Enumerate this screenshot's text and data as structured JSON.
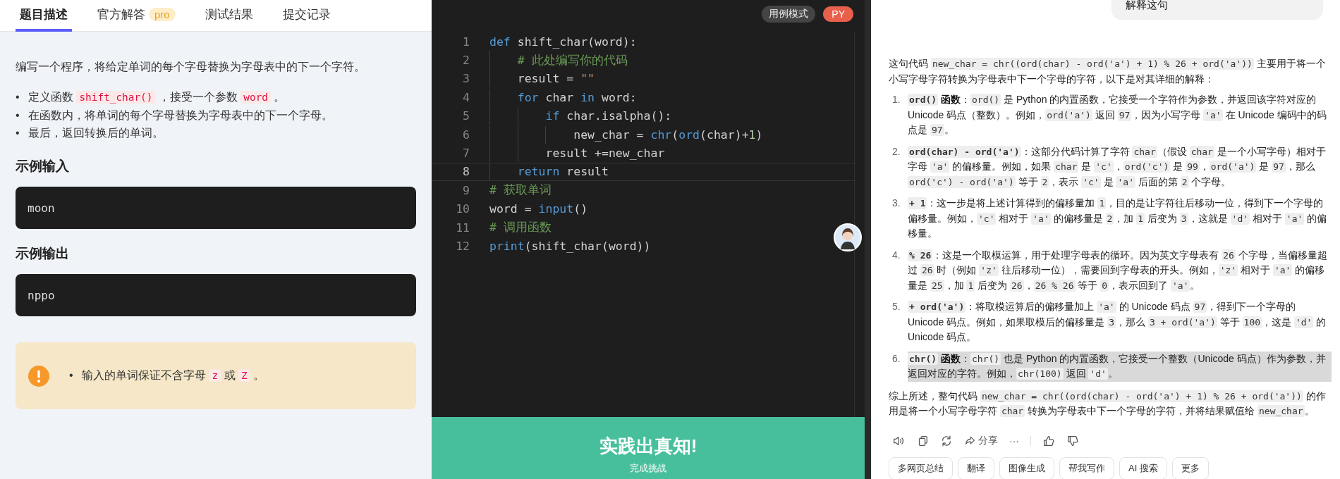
{
  "problem": {
    "tabs": [
      {
        "label": "题目描述",
        "selected": true
      },
      {
        "label": "官方解答",
        "selected": false,
        "badge": "pro"
      },
      {
        "label": "测试结果",
        "selected": false
      },
      {
        "label": "提交记录",
        "selected": false
      }
    ],
    "description": "编写一个程序，将给定单词的每个字母替换为字母表中的下一个字符。",
    "bullets": [
      {
        "marker": "•",
        "segments": [
          {
            "kind": "text",
            "text": "定义函数 "
          },
          {
            "kind": "code",
            "text": "shift_char()"
          },
          {
            "kind": "text",
            "text": " ，接受一个参数 "
          },
          {
            "kind": "code",
            "text": "word"
          },
          {
            "kind": "text",
            "text": " 。"
          }
        ]
      },
      {
        "marker": "•",
        "segments": [
          {
            "kind": "text",
            "text": "在函数内，将单词的每个字母替换为字母表中的下一个字母。"
          }
        ]
      },
      {
        "marker": "•",
        "segments": [
          {
            "kind": "text",
            "text": "最后，返回转换后的单词。"
          }
        ]
      }
    ],
    "examples": [
      {
        "heading": "示例输入",
        "value": "moon"
      },
      {
        "heading": "示例输出",
        "value": "nppo"
      }
    ],
    "notice": [
      {
        "marker": "•",
        "segments": [
          {
            "kind": "text",
            "text": "输入的单词保证不含字母 "
          },
          {
            "kind": "code",
            "text": "z"
          },
          {
            "kind": "text",
            "text": " 或 "
          },
          {
            "kind": "code",
            "text": "Z"
          },
          {
            "kind": "text",
            "text": " 。"
          }
        ]
      }
    ]
  },
  "editor": {
    "mode_badge": "用例模式",
    "language_badge": "PY",
    "lines": [
      {
        "number": "1",
        "current": false,
        "tokens": [
          {
            "kind": "keyword",
            "text": "def"
          },
          {
            "kind": "plain",
            "text": " shift_char(word):"
          }
        ]
      },
      {
        "number": "2",
        "current": false,
        "tokens": [
          {
            "kind": "comment",
            "text": "    # 此处编写你的代码"
          }
        ]
      },
      {
        "number": "3",
        "current": false,
        "tokens": [
          {
            "kind": "plain",
            "text": "    result = "
          },
          {
            "kind": "string",
            "text": "\"\""
          }
        ]
      },
      {
        "number": "4",
        "current": false,
        "tokens": [
          {
            "kind": "keyword",
            "text": "    for"
          },
          {
            "kind": "plain",
            "text": " char "
          },
          {
            "kind": "keyword",
            "text": "in"
          },
          {
            "kind": "plain",
            "text": " word:"
          }
        ]
      },
      {
        "number": "5",
        "current": false,
        "tokens": [
          {
            "kind": "keyword",
            "text": "        if"
          },
          {
            "kind": "plain",
            "text": " char.isalpha():"
          }
        ]
      },
      {
        "number": "6",
        "current": false,
        "tokens": [
          {
            "kind": "plain",
            "text": "            new_char = "
          },
          {
            "kind": "function",
            "text": "chr"
          },
          {
            "kind": "plain",
            "text": "("
          },
          {
            "kind": "function",
            "text": "ord"
          },
          {
            "kind": "plain",
            "text": "(char)+"
          },
          {
            "kind": "number",
            "text": "1"
          },
          {
            "kind": "plain",
            "text": ")"
          }
        ]
      },
      {
        "number": "7",
        "current": false,
        "tokens": [
          {
            "kind": "plain",
            "text": "        result +=new_char"
          }
        ]
      },
      {
        "number": "8",
        "current": true,
        "tokens": [
          {
            "kind": "keyword",
            "text": "    return"
          },
          {
            "kind": "plain",
            "text": " result"
          }
        ]
      },
      {
        "number": "9",
        "current": false,
        "tokens": [
          {
            "kind": "comment",
            "text": "# 获取单词"
          }
        ]
      },
      {
        "number": "10",
        "current": false,
        "tokens": [
          {
            "kind": "plain",
            "text": "word = "
          },
          {
            "kind": "function",
            "text": "input"
          },
          {
            "kind": "plain",
            "text": "()"
          }
        ]
      },
      {
        "number": "11",
        "current": false,
        "tokens": [
          {
            "kind": "comment",
            "text": "# 调用函数"
          }
        ]
      },
      {
        "number": "12",
        "current": false,
        "tokens": [
          {
            "kind": "function",
            "text": "print"
          },
          {
            "kind": "plain",
            "text": "(shift_char(word))"
          }
        ]
      }
    ]
  },
  "banner": {
    "title": "实践出真知!",
    "subtitle": "完成挑战"
  },
  "chat": {
    "user_message": "解释这句",
    "intro": [
      {
        "kind": "text",
        "text": "这句代码 "
      },
      {
        "kind": "code",
        "text": "new_char = chr((ord(char) - ord('a') + 1) % 26 + ord('a'))"
      },
      {
        "kind": "text",
        "text": " 主要用于将一个小写字母字符转换为字母表中下一个字母的字符，以下是对其详细的解释："
      }
    ],
    "items": [
      {
        "number": "1.",
        "highlighted": false,
        "segments": [
          {
            "kind": "bold-code",
            "text": "ord()"
          },
          {
            "kind": "bold",
            "text": " 函数"
          },
          {
            "kind": "text",
            "text": "："
          },
          {
            "kind": "code",
            "text": "ord()"
          },
          {
            "kind": "text",
            "text": " 是 Python 的内置函数，它接受一个字符作为参数，并返回该字符对应的 Unicode 码点（整数）。例如，"
          },
          {
            "kind": "code",
            "text": "ord('a')"
          },
          {
            "kind": "text",
            "text": " 返回 "
          },
          {
            "kind": "code",
            "text": "97"
          },
          {
            "kind": "text",
            "text": "，因为小写字母 "
          },
          {
            "kind": "code",
            "text": "'a'"
          },
          {
            "kind": "text",
            "text": " 在 Unicode 编码中的码点是 "
          },
          {
            "kind": "code",
            "text": "97"
          },
          {
            "kind": "text",
            "text": "。"
          }
        ]
      },
      {
        "number": "2.",
        "highlighted": false,
        "segments": [
          {
            "kind": "bold-code",
            "text": "ord(char) - ord('a')"
          },
          {
            "kind": "text",
            "text": "：这部分代码计算了字符 "
          },
          {
            "kind": "code",
            "text": "char"
          },
          {
            "kind": "text",
            "text": "（假设 "
          },
          {
            "kind": "code",
            "text": "char"
          },
          {
            "kind": "text",
            "text": " 是一个小写字母）相对于字母 "
          },
          {
            "kind": "code",
            "text": "'a'"
          },
          {
            "kind": "text",
            "text": " 的偏移量。例如，如果 "
          },
          {
            "kind": "code",
            "text": "char"
          },
          {
            "kind": "text",
            "text": " 是 "
          },
          {
            "kind": "code",
            "text": "'c'"
          },
          {
            "kind": "text",
            "text": "，"
          },
          {
            "kind": "code",
            "text": "ord('c')"
          },
          {
            "kind": "text",
            "text": " 是 "
          },
          {
            "kind": "code",
            "text": "99"
          },
          {
            "kind": "text",
            "text": "，"
          },
          {
            "kind": "code",
            "text": "ord('a')"
          },
          {
            "kind": "text",
            "text": " 是 "
          },
          {
            "kind": "code",
            "text": "97"
          },
          {
            "kind": "text",
            "text": "，那么 "
          },
          {
            "kind": "code",
            "text": "ord('c') - ord('a')"
          },
          {
            "kind": "text",
            "text": " 等于 "
          },
          {
            "kind": "code",
            "text": "2"
          },
          {
            "kind": "text",
            "text": "，表示 "
          },
          {
            "kind": "code",
            "text": "'c'"
          },
          {
            "kind": "text",
            "text": " 是 "
          },
          {
            "kind": "code",
            "text": "'a'"
          },
          {
            "kind": "text",
            "text": " 后面的第 "
          },
          {
            "kind": "code",
            "text": "2"
          },
          {
            "kind": "text",
            "text": " 个字母。"
          }
        ]
      },
      {
        "number": "3.",
        "highlighted": false,
        "segments": [
          {
            "kind": "bold-code",
            "text": "+ 1"
          },
          {
            "kind": "text",
            "text": "：这一步是将上述计算得到的偏移量加 "
          },
          {
            "kind": "code",
            "text": "1"
          },
          {
            "kind": "text",
            "text": "，目的是让字符往后移动一位，得到下一个字母的偏移量。例如，"
          },
          {
            "kind": "code",
            "text": "'c'"
          },
          {
            "kind": "text",
            "text": " 相对于 "
          },
          {
            "kind": "code",
            "text": "'a'"
          },
          {
            "kind": "text",
            "text": " 的偏移量是 "
          },
          {
            "kind": "code",
            "text": "2"
          },
          {
            "kind": "text",
            "text": "，加 "
          },
          {
            "kind": "code",
            "text": "1"
          },
          {
            "kind": "text",
            "text": " 后变为 "
          },
          {
            "kind": "code",
            "text": "3"
          },
          {
            "kind": "text",
            "text": "，这就是 "
          },
          {
            "kind": "code",
            "text": "'d'"
          },
          {
            "kind": "text",
            "text": " 相对于 "
          },
          {
            "kind": "code",
            "text": "'a'"
          },
          {
            "kind": "text",
            "text": " 的偏移量。"
          }
        ]
      },
      {
        "number": "4.",
        "highlighted": false,
        "segments": [
          {
            "kind": "bold-code",
            "text": "% 26"
          },
          {
            "kind": "text",
            "text": "：这是一个取模运算，用于处理字母表的循环。因为英文字母表有 "
          },
          {
            "kind": "code",
            "text": "26"
          },
          {
            "kind": "text",
            "text": " 个字母，当偏移量超过 "
          },
          {
            "kind": "code",
            "text": "26"
          },
          {
            "kind": "text",
            "text": " 时（例如 "
          },
          {
            "kind": "code",
            "text": "'z'"
          },
          {
            "kind": "text",
            "text": " 往后移动一位），需要回到字母表的开头。例如，"
          },
          {
            "kind": "code",
            "text": "'z'"
          },
          {
            "kind": "text",
            "text": " 相对于 "
          },
          {
            "kind": "code",
            "text": "'a'"
          },
          {
            "kind": "text",
            "text": " 的偏移量是 "
          },
          {
            "kind": "code",
            "text": "25"
          },
          {
            "kind": "text",
            "text": "，加 "
          },
          {
            "kind": "code",
            "text": "1"
          },
          {
            "kind": "text",
            "text": " 后变为 "
          },
          {
            "kind": "code",
            "text": "26"
          },
          {
            "kind": "text",
            "text": "，"
          },
          {
            "kind": "code",
            "text": "26 % 26"
          },
          {
            "kind": "text",
            "text": " 等于 "
          },
          {
            "kind": "code",
            "text": "0"
          },
          {
            "kind": "text",
            "text": "，表示回到了 "
          },
          {
            "kind": "code",
            "text": "'a'"
          },
          {
            "kind": "text",
            "text": "。"
          }
        ]
      },
      {
        "number": "5.",
        "highlighted": false,
        "segments": [
          {
            "kind": "bold-code",
            "text": "+ ord('a')"
          },
          {
            "kind": "text",
            "text": "：将取模运算后的偏移量加上 "
          },
          {
            "kind": "code",
            "text": "'a'"
          },
          {
            "kind": "text",
            "text": " 的 Unicode 码点 "
          },
          {
            "kind": "code",
            "text": "97"
          },
          {
            "kind": "text",
            "text": "，得到下一个字母的 Unicode 码点。例如，如果取模后的偏移量是 "
          },
          {
            "kind": "code",
            "text": "3"
          },
          {
            "kind": "text",
            "text": "，那么 "
          },
          {
            "kind": "code",
            "text": "3 + ord('a')"
          },
          {
            "kind": "text",
            "text": " 等于 "
          },
          {
            "kind": "code",
            "text": "100"
          },
          {
            "kind": "text",
            "text": "，这是 "
          },
          {
            "kind": "code",
            "text": "'d'"
          },
          {
            "kind": "text",
            "text": " 的 Unicode 码点。"
          }
        ]
      },
      {
        "number": "6.",
        "highlighted": true,
        "segments": [
          {
            "kind": "bold-code",
            "text": "chr()"
          },
          {
            "kind": "bold",
            "text": " 函数"
          },
          {
            "kind": "text",
            "text": "："
          },
          {
            "kind": "code",
            "text": "chr()"
          },
          {
            "kind": "text",
            "text": " 也是 Python 的内置函数，它接受一个整数（Unicode 码点）作为参数，并返回对应的字符。例如，"
          },
          {
            "kind": "code",
            "text": "chr(100)"
          },
          {
            "kind": "text",
            "text": " 返回 "
          },
          {
            "kind": "code",
            "text": "'d'"
          },
          {
            "kind": "text",
            "text": "。"
          }
        ]
      }
    ],
    "summary": [
      {
        "kind": "text",
        "text": "综上所述，整句代码 "
      },
      {
        "kind": "code",
        "text": "new_char = chr((ord(char) - ord('a') + 1) % 26 + ord('a'))"
      },
      {
        "kind": "text",
        "text": " 的作用是将一个小写字母字符 "
      },
      {
        "kind": "code",
        "text": "char"
      },
      {
        "kind": "text",
        "text": " 转换为字母表中下一个字母的字符，并将结果赋值给 "
      },
      {
        "kind": "code",
        "text": "new_char"
      },
      {
        "kind": "text",
        "text": "。"
      }
    ],
    "share_label": "分享",
    "more_label": "···",
    "suggestions": [
      "多网页总结",
      "翻译",
      "图像生成",
      "帮我写作",
      "AI 搜索",
      "更多"
    ]
  }
}
